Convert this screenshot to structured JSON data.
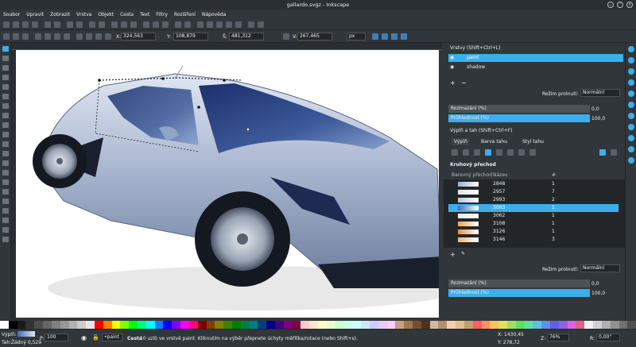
{
  "window": {
    "title": "gallardo.svgz - Inkscape"
  },
  "menu": [
    "Soubor",
    "Upravit",
    "Zobrazit",
    "Vrstva",
    "Objekt",
    "Cesta",
    "Text",
    "Filtry",
    "Rozšíření",
    "Nápověda"
  ],
  "controls": {
    "x_label": "X:",
    "x_value": "324,563",
    "y_label": "Y:",
    "y_value": "108,879",
    "w_label": "Š:",
    "w_value": "481,312",
    "h_label": "V:",
    "h_value": "267,465",
    "unit": "px"
  },
  "layers": {
    "header": "Vrstvy (Shift+Ctrl+L)",
    "items": [
      {
        "name": "paint",
        "selected": true
      },
      {
        "name": "shadow",
        "selected": false
      }
    ],
    "blend_label": "Režim prolnutí:",
    "blend_value": "Normální",
    "blur_label": "Rozmazání (%)",
    "blur_value": "0,0",
    "opacity_label": "Průhlednost (%)",
    "opacity_value": "100,0"
  },
  "fillstroke": {
    "header": "Výplň a tah (Shift+Ctrl+F)",
    "tabs": [
      "Výplň",
      "Barva tahu",
      "Styl tahu"
    ],
    "gradient_title": "Kruhový přechod",
    "col_gradient": "Barevný přechod",
    "col_name": "Název",
    "col_count": "#",
    "gradients": [
      {
        "name": "2848",
        "count": "1",
        "color": "#9fb0c8"
      },
      {
        "name": "2957",
        "count": "7",
        "color": "#dfe3ea"
      },
      {
        "name": "2993",
        "count": "2",
        "color": "#b8c4d8"
      },
      {
        "name": "3003",
        "count": "1",
        "color": "#3d6fb6",
        "selected": true
      },
      {
        "name": "3062",
        "count": "1",
        "color": "#e8e8e8"
      },
      {
        "name": "3108",
        "count": "1",
        "color": "#f0a050"
      },
      {
        "name": "3126",
        "count": "1",
        "color": "#e89048"
      },
      {
        "name": "3146",
        "count": "3",
        "color": "#f0b070"
      }
    ],
    "blend_label": "Režim prolnutí:",
    "blend_value": "Normální",
    "blur_label": "Rozmazání (%)",
    "blur_value": "0,0",
    "opacity_label": "Průhlednost (%)",
    "opacity_value": "100,0"
  },
  "status": {
    "fill_label": "Výplň:",
    "stroke_label": "Tah:",
    "stroke_value": "Žádný 0,529",
    "opacity_label": "P:",
    "opacity_value": "100",
    "layer": "•paint",
    "message_bold": "Cesta",
    "message": " 10 uzlů ve vrstvě paint. Kliknutím na výběr přepnete úchyty měřítka/rotace (nebo Shift+s).",
    "coord_x": "X: 1430,45",
    "coord_y": "Y: 278,72",
    "zoom_label": "Z:",
    "zoom": "76%",
    "rotate_label": "R:",
    "rotate": "0,00°"
  },
  "palette": [
    "#ffffff",
    "#000000",
    "#1a1a1a",
    "#333333",
    "#4d4d4d",
    "#666666",
    "#808080",
    "#999999",
    "#b3b3b3",
    "#cccccc",
    "#e6e6e6",
    "#ff0000",
    "#ff8000",
    "#ffff00",
    "#80ff00",
    "#00ff00",
    "#00ff80",
    "#00ffff",
    "#0080ff",
    "#0000ff",
    "#8000ff",
    "#ff00ff",
    "#ff0080",
    "#800000",
    "#804000",
    "#808000",
    "#408000",
    "#008000",
    "#008040",
    "#008080",
    "#004080",
    "#000080",
    "#400080",
    "#800080",
    "#800040",
    "#ffcccc",
    "#ffe6cc",
    "#ffffcc",
    "#e6ffcc",
    "#ccffcc",
    "#ccffe6",
    "#ccffff",
    "#cce6ff",
    "#ccccff",
    "#e6ccff",
    "#ffccff",
    "#c8a080",
    "#a07850",
    "#785030",
    "#503020",
    "#d0b8a0",
    "#b09070",
    "#f0d0b0",
    "#e0c090",
    "#c0a070",
    "#ff6060",
    "#ff9060",
    "#ffc060",
    "#e0e060",
    "#a0e060",
    "#60e060",
    "#60e0a0",
    "#60c0e0",
    "#6090e0",
    "#6060e0",
    "#9060e0",
    "#e060e0",
    "#e06090",
    "#f0f0f0",
    "#d0d0d0",
    "#b0b0b0",
    "#909090",
    "#707070",
    "#505050"
  ]
}
